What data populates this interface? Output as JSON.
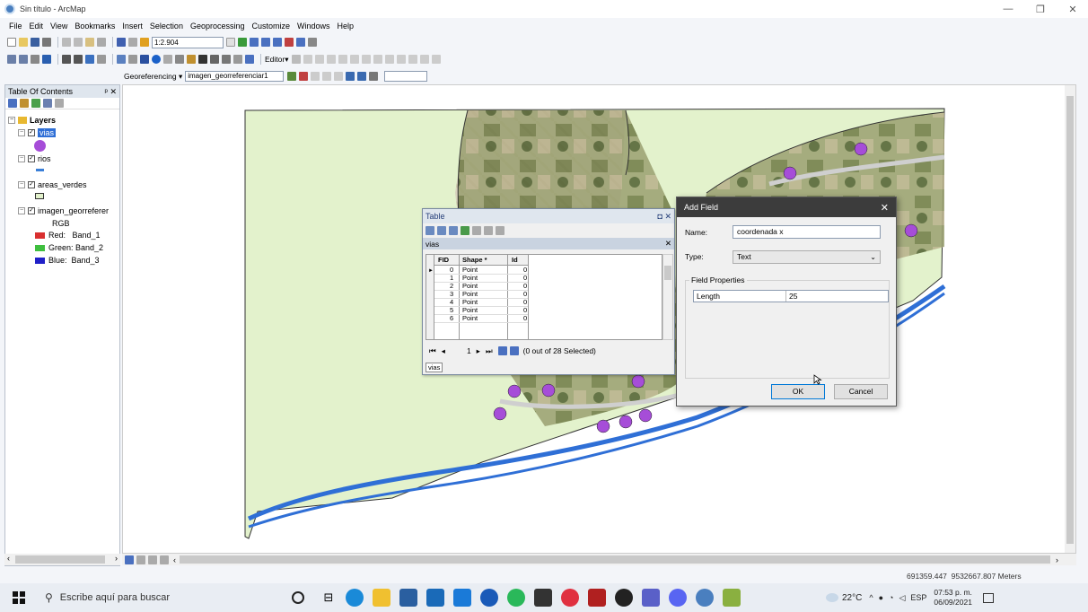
{
  "window": {
    "title": "Sin título - ArcMap"
  },
  "menu": [
    "File",
    "Edit",
    "View",
    "Bookmarks",
    "Insert",
    "Selection",
    "Geoprocessing",
    "Customize",
    "Windows",
    "Help"
  ],
  "toolbar": {
    "scale": "1:2.904",
    "editor_label": "Editor▾"
  },
  "georef": {
    "label": "Georeferencing ▾",
    "layer": "imagen_georreferenciar1"
  },
  "toc": {
    "title": "Table Of Contents",
    "layers_label": "Layers",
    "layers": [
      {
        "name": "vias",
        "selected": true
      },
      {
        "name": "rios"
      },
      {
        "name": "areas_verdes"
      },
      {
        "name": "imagen_georreferer"
      }
    ],
    "rgb_label": "RGB",
    "bands": [
      {
        "label": "Red:   Band_1",
        "color": "#d93030"
      },
      {
        "label": "Green: Band_2",
        "color": "#3fbf3f"
      },
      {
        "label": "Blue:  Band_3",
        "color": "#2020c8"
      }
    ]
  },
  "table": {
    "title": "Table",
    "tab": "vias",
    "columns": [
      "FID",
      "Shape *",
      "Id"
    ],
    "rows": [
      [
        "0",
        "Point",
        "0"
      ],
      [
        "1",
        "Point",
        "0"
      ],
      [
        "2",
        "Point",
        "0"
      ],
      [
        "3",
        "Point",
        "0"
      ],
      [
        "4",
        "Point",
        "0"
      ],
      [
        "5",
        "Point",
        "0"
      ],
      [
        "6",
        "Point",
        "0"
      ]
    ],
    "record": "1",
    "selection": "(0 out of 28 Selected)",
    "bottom_tab": "vias"
  },
  "add_field": {
    "title": "Add Field",
    "name_label": "Name:",
    "name_value": "coordenada x",
    "type_label": "Type:",
    "type_value": "Text",
    "props_label": "Field Properties",
    "length_label": "Length",
    "length_value": "25",
    "ok": "OK",
    "cancel": "Cancel"
  },
  "status": {
    "coords": "691359.447  9532667.807 Meters"
  },
  "taskbar": {
    "search_placeholder": "Escribe aquí para buscar",
    "weather": "22°C",
    "lang": "ESP",
    "time": "07:53 p. m.",
    "date": "06/09/2021"
  },
  "colors": {
    "accent": "#0078d7",
    "map_green": "#e3f2cc",
    "point": "#a64dd8",
    "river": "#3a7fd8"
  }
}
